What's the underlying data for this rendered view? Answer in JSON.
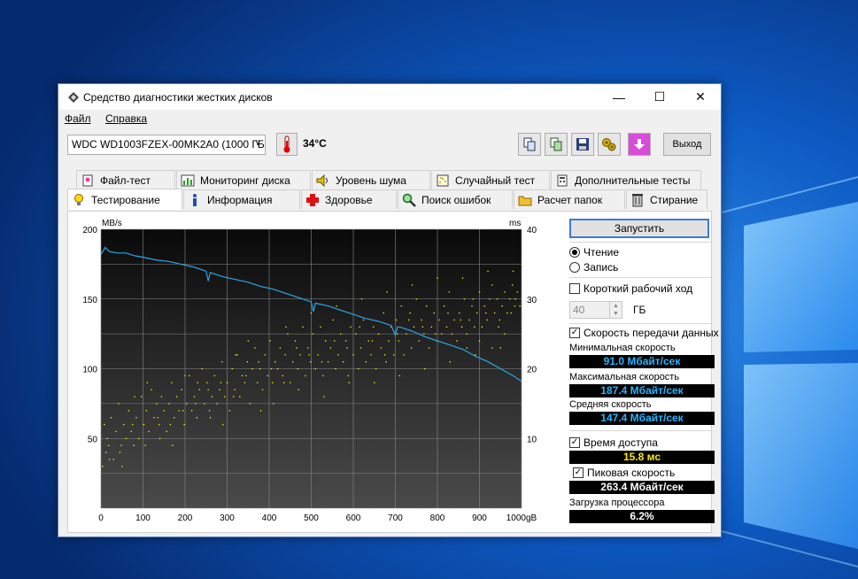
{
  "window": {
    "title": "Средство диагностики жестких дисков",
    "menu": [
      "Файл",
      "Справка"
    ]
  },
  "toolbar": {
    "drive": "WDC WD1003FZEX-00MK2A0 (1000 ГБ)",
    "temperature": "34°C",
    "exit_label": "Выход"
  },
  "tabs": {
    "row1": [
      "Файл-тест",
      "Мониторинг диска",
      "Уровень шума",
      "Случайный тест",
      "Дополнительные тесты"
    ],
    "row2": [
      "Тестирование",
      "Информация",
      "Здоровье",
      "Поиск ошибок",
      "Расчет папок",
      "Стирание"
    ],
    "active": "Тестирование"
  },
  "panel": {
    "start_label": "Запустить",
    "mode_read": "Чтение",
    "mode_write": "Запись",
    "mode_selected": "read",
    "short_stroke_label": "Короткий рабочий ход",
    "short_stroke_checked": false,
    "short_stroke_value": "40",
    "short_stroke_unit": "ГБ",
    "transfer_rate_label": "Скорость передачи данных",
    "transfer_rate_checked": true,
    "min_label": "Минимальная скорость",
    "min_value": "91.0 Мбайт/сек",
    "max_label": "Максимальная скорость",
    "max_value": "187.4 Мбайт/сек",
    "avg_label": "Средняя скорость",
    "avg_value": "147.4 Мбайт/сек",
    "access_label": "Время доступа",
    "access_checked": true,
    "access_value": "15.8 мс",
    "burst_label": "Пиковая скорость",
    "burst_checked": true,
    "burst_value": "263.4 Мбайт/сек",
    "cpu_label": "Загрузка процессора",
    "cpu_value": "6.2%"
  },
  "chart_data": {
    "type": "line",
    "ylabel_left": "MB/s",
    "ylabel_right": "ms",
    "x_ticks": [
      "0",
      "100",
      "200",
      "300",
      "400",
      "500",
      "600",
      "700",
      "800",
      "900",
      "1000gB"
    ],
    "y_left_ticks": [
      "50",
      "100",
      "150",
      "200"
    ],
    "y_right_ticks": [
      "10",
      "20",
      "30",
      "40"
    ],
    "xlim": [
      0,
      1000
    ],
    "ylim_left": [
      0,
      200
    ],
    "ylim_right": [
      0,
      40
    ],
    "grid": true,
    "series": [
      {
        "axis": "left",
        "color": "#28a8e8",
        "x": [
          0,
          10,
          20,
          40,
          60,
          80,
          100,
          130,
          160,
          190,
          220,
          250,
          255,
          260,
          290,
          320,
          350,
          380,
          410,
          440,
          470,
          500,
          505,
          510,
          540,
          570,
          600,
          630,
          660,
          690,
          700,
          705,
          710,
          740,
          770,
          800,
          830,
          860,
          890,
          920,
          950,
          980,
          1000
        ],
        "y": [
          182,
          187,
          184,
          183,
          183,
          181,
          180,
          178,
          177,
          175,
          173,
          170,
          163,
          169,
          166,
          164,
          162,
          159,
          157,
          154,
          151,
          148,
          141,
          147,
          145,
          142,
          139,
          136,
          134,
          131,
          124,
          130,
          130,
          127,
          123,
          120,
          117,
          114,
          109,
          105,
          100,
          95,
          91
        ]
      }
    ],
    "scatter": {
      "axis": "right",
      "color": "#ffff00",
      "points": [
        [
          4,
          6
        ],
        [
          8,
          12
        ],
        [
          12,
          8
        ],
        [
          18,
          9
        ],
        [
          24,
          13
        ],
        [
          30,
          7
        ],
        [
          36,
          11
        ],
        [
          42,
          15
        ],
        [
          48,
          9
        ],
        [
          54,
          12
        ],
        [
          60,
          10
        ],
        [
          66,
          14
        ],
        [
          72,
          11
        ],
        [
          78,
          9
        ],
        [
          84,
          13
        ],
        [
          90,
          10
        ],
        [
          96,
          16
        ],
        [
          102,
          12
        ],
        [
          108,
          14
        ],
        [
          114,
          11
        ],
        [
          120,
          17
        ],
        [
          126,
          13
        ],
        [
          132,
          15
        ],
        [
          138,
          12
        ],
        [
          144,
          16
        ],
        [
          150,
          14
        ],
        [
          156,
          11
        ],
        [
          162,
          15
        ],
        [
          168,
          18
        ],
        [
          174,
          13
        ],
        [
          180,
          16
        ],
        [
          186,
          14
        ],
        [
          192,
          17
        ],
        [
          198,
          12
        ],
        [
          204,
          15
        ],
        [
          210,
          19
        ],
        [
          216,
          14
        ],
        [
          222,
          16
        ],
        [
          228,
          13
        ],
        [
          234,
          17
        ],
        [
          240,
          20
        ],
        [
          246,
          15
        ],
        [
          252,
          18
        ],
        [
          258,
          14
        ],
        [
          264,
          16
        ],
        [
          270,
          19
        ],
        [
          276,
          15
        ],
        [
          282,
          17
        ],
        [
          288,
          21
        ],
        [
          294,
          16
        ],
        [
          300,
          18
        ],
        [
          306,
          14
        ],
        [
          312,
          20
        ],
        [
          318,
          17
        ],
        [
          324,
          22
        ],
        [
          330,
          16
        ],
        [
          336,
          19
        ],
        [
          342,
          18
        ],
        [
          348,
          21
        ],
        [
          354,
          15
        ],
        [
          360,
          20
        ],
        [
          366,
          23
        ],
        [
          372,
          18
        ],
        [
          378,
          20
        ],
        [
          384,
          17
        ],
        [
          390,
          22
        ],
        [
          396,
          19
        ],
        [
          402,
          24
        ],
        [
          408,
          18
        ],
        [
          414,
          21
        ],
        [
          420,
          20
        ],
        [
          426,
          23
        ],
        [
          432,
          19
        ],
        [
          438,
          22
        ],
        [
          444,
          25
        ],
        [
          450,
          18
        ],
        [
          456,
          21
        ],
        [
          462,
          24
        ],
        [
          468,
          20
        ],
        [
          474,
          22
        ],
        [
          480,
          26
        ],
        [
          486,
          19
        ],
        [
          492,
          23
        ],
        [
          498,
          21
        ],
        [
          504,
          25
        ],
        [
          510,
          20
        ],
        [
          516,
          22
        ],
        [
          522,
          26
        ],
        [
          528,
          19
        ],
        [
          534,
          24
        ],
        [
          540,
          21
        ],
        [
          546,
          23
        ],
        [
          552,
          27
        ],
        [
          558,
          20
        ],
        [
          564,
          22
        ],
        [
          570,
          25
        ],
        [
          576,
          21
        ],
        [
          582,
          24
        ],
        [
          588,
          19
        ],
        [
          594,
          26
        ],
        [
          600,
          22
        ],
        [
          606,
          25
        ],
        [
          612,
          20
        ],
        [
          618,
          23
        ],
        [
          624,
          27
        ],
        [
          630,
          21
        ],
        [
          636,
          24
        ],
        [
          642,
          22
        ],
        [
          648,
          26
        ],
        [
          654,
          20
        ],
        [
          660,
          25
        ],
        [
          666,
          23
        ],
        [
          672,
          28
        ],
        [
          678,
          21
        ],
        [
          684,
          24
        ],
        [
          690,
          26
        ],
        [
          696,
          22
        ],
        [
          702,
          27
        ],
        [
          708,
          24
        ],
        [
          714,
          29
        ],
        [
          720,
          22
        ],
        [
          726,
          25
        ],
        [
          732,
          27
        ],
        [
          738,
          23
        ],
        [
          744,
          26
        ],
        [
          750,
          30
        ],
        [
          756,
          24
        ],
        [
          762,
          27
        ],
        [
          768,
          25
        ],
        [
          774,
          29
        ],
        [
          780,
          23
        ],
        [
          786,
          26
        ],
        [
          792,
          28
        ],
        [
          798,
          24
        ],
        [
          804,
          27
        ],
        [
          810,
          25
        ],
        [
          816,
          29
        ],
        [
          822,
          26
        ],
        [
          828,
          31
        ],
        [
          834,
          25
        ],
        [
          840,
          27
        ],
        [
          846,
          24
        ],
        [
          852,
          28
        ],
        [
          858,
          26
        ],
        [
          864,
          30
        ],
        [
          870,
          25
        ],
        [
          876,
          27
        ],
        [
          882,
          29
        ],
        [
          888,
          26
        ],
        [
          894,
          28
        ],
        [
          900,
          31
        ],
        [
          906,
          26
        ],
        [
          912,
          29
        ],
        [
          918,
          27
        ],
        [
          924,
          30
        ],
        [
          930,
          32
        ],
        [
          936,
          28
        ],
        [
          942,
          30
        ],
        [
          948,
          27
        ],
        [
          954,
          29
        ],
        [
          960,
          31
        ],
        [
          966,
          28
        ],
        [
          972,
          30
        ],
        [
          978,
          32
        ],
        [
          984,
          29
        ],
        [
          990,
          31
        ],
        [
          996,
          29
        ],
        [
          15,
          10
        ],
        [
          45,
          8
        ],
        [
          75,
          12
        ],
        [
          105,
          9
        ],
        [
          135,
          13
        ],
        [
          165,
          12
        ],
        [
          195,
          14
        ],
        [
          225,
          15
        ],
        [
          255,
          17
        ],
        [
          285,
          18
        ],
        [
          315,
          16
        ],
        [
          345,
          19
        ],
        [
          375,
          21
        ],
        [
          405,
          20
        ],
        [
          435,
          18
        ],
        [
          465,
          23
        ],
        [
          495,
          22
        ],
        [
          525,
          21
        ],
        [
          555,
          24
        ],
        [
          585,
          23
        ],
        [
          615,
          26
        ],
        [
          645,
          24
        ],
        [
          675,
          22
        ],
        [
          705,
          25
        ],
        [
          735,
          28
        ],
        [
          765,
          26
        ],
        [
          795,
          25
        ],
        [
          825,
          28
        ],
        [
          855,
          27
        ],
        [
          885,
          30
        ],
        [
          915,
          28
        ],
        [
          945,
          26
        ],
        [
          975,
          28
        ],
        [
          20,
          7
        ],
        [
          50,
          6
        ],
        [
          80,
          16
        ],
        [
          110,
          18
        ],
        [
          140,
          10
        ],
        [
          170,
          9
        ],
        [
          200,
          19
        ],
        [
          230,
          18
        ],
        [
          260,
          13
        ],
        [
          290,
          12
        ],
        [
          320,
          22
        ],
        [
          350,
          24
        ],
        [
          380,
          14
        ],
        [
          410,
          15
        ],
        [
          440,
          26
        ],
        [
          470,
          17
        ],
        [
          500,
          28
        ],
        [
          530,
          16
        ],
        [
          560,
          29
        ],
        [
          590,
          18
        ],
        [
          620,
          30
        ],
        [
          650,
          18
        ],
        [
          680,
          31
        ],
        [
          710,
          19
        ],
        [
          740,
          32
        ],
        [
          770,
          20
        ],
        [
          800,
          33
        ],
        [
          830,
          21
        ],
        [
          860,
          33
        ],
        [
          890,
          22
        ],
        [
          920,
          34
        ],
        [
          950,
          23
        ],
        [
          980,
          34
        ],
        [
          985,
          30
        ],
        [
          960,
          25
        ],
        [
          930,
          23
        ],
        [
          900,
          24
        ],
        [
          870,
          23
        ]
      ]
    }
  }
}
